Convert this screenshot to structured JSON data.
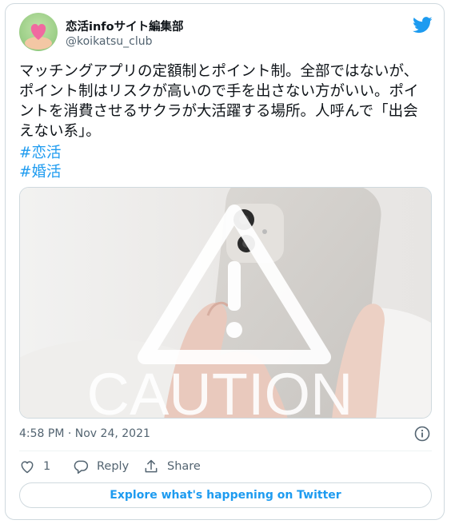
{
  "author": {
    "name": "恋活infoサイト編集部",
    "handle": "@koikatsu_club"
  },
  "tweet": {
    "text": "マッチングアプリの定額制とポイント制。全部ではないが、ポイント制はリスクが高いので手を出さない方がいい。ポイントを消費させるサクラが大活躍する場所。人呼んで「出会えない系」。",
    "hashtags": [
      "#恋活",
      "#婚活"
    ]
  },
  "media": {
    "caption_text": "CAUTION"
  },
  "meta": {
    "timestamp": "4:58 PM · Nov 24, 2021"
  },
  "actions": {
    "like_count": "1",
    "reply_label": "Reply",
    "share_label": "Share"
  },
  "footer": {
    "explore_label": "Explore what's happening on Twitter"
  },
  "colors": {
    "accent": "#1d9bf0",
    "text": "#0f1419",
    "muted": "#536471",
    "border": "#cfd9de"
  },
  "icons": [
    "twitter-bird-icon",
    "info-icon",
    "heart-icon",
    "reply-icon",
    "share-icon",
    "heart-emblem-icon"
  ]
}
